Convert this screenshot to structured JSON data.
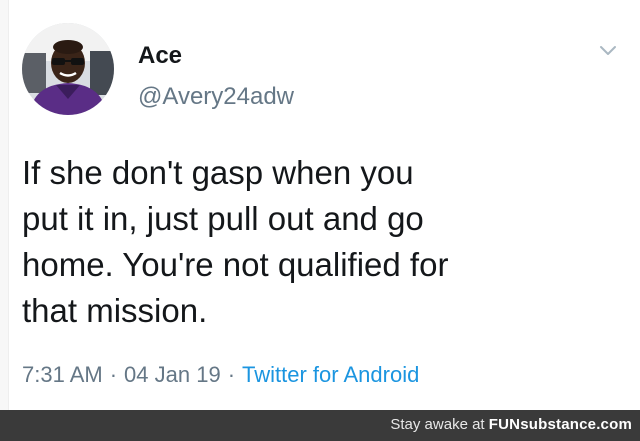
{
  "tweet": {
    "author_name": "Ace",
    "author_handle": "@Avery24adw",
    "text_lines": [
      "If she don't gasp when you",
      "put it in, just pull out and go",
      "home. You're not qualified for",
      "that mission."
    ],
    "time": "7:31 AM",
    "separator": "·",
    "date": "04 Jan 19",
    "source": "Twitter for Android",
    "menu_icon": "chevron-down-icon",
    "avatar_icon": "avatar"
  },
  "footer": {
    "prefix": "Stay awake at ",
    "brand": "FUNsubstance.com"
  },
  "colors": {
    "text": "#14171a",
    "secondary": "#657786",
    "link": "#1b95e0",
    "footer_bg": "#3a3a3a"
  }
}
